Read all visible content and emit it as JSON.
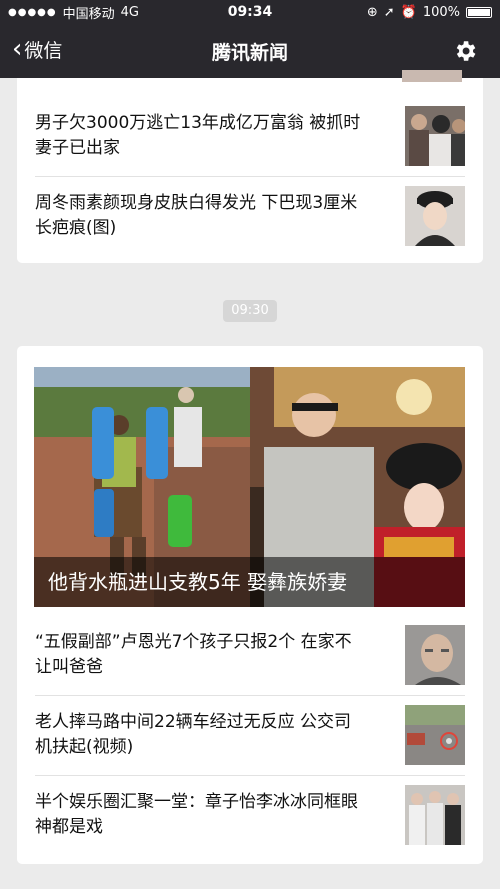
{
  "status": {
    "carrier": "中国移动",
    "network": "4G",
    "time": "09:34",
    "battery": "100%"
  },
  "nav": {
    "back_label": "微信",
    "title": "腾讯新闻"
  },
  "top_card": {
    "items": [
      {
        "title": "男子欠3000万逃亡13年成亿万富翁 被抓时妻子已出家"
      },
      {
        "title": "周冬雨素颜现身皮肤白得发光 下巴现3厘米长疤痕(图)"
      }
    ]
  },
  "timestamp": "09:30",
  "bottom_card": {
    "hero_caption": "他背水瓶进山支教5年 娶彝族娇妻",
    "items": [
      {
        "title": "“五假副部”卢恩光7个孩子只报2个 在家不让叫爸爸"
      },
      {
        "title": "老人摔马路中间22辆车经过无反应 公交司机扶起(视频)"
      },
      {
        "title": "半个娱乐圈汇聚一堂：章子怡李冰冰同框眼神都是戏"
      }
    ]
  }
}
